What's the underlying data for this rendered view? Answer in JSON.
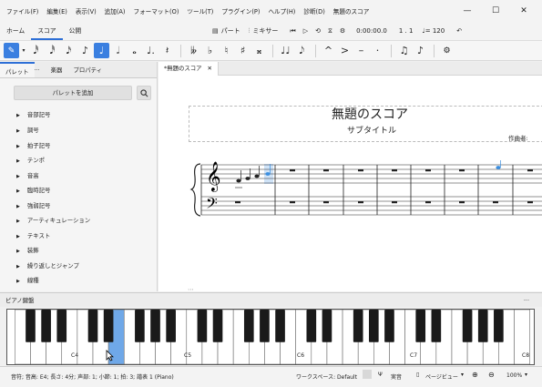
{
  "menu": [
    "ファイル(F)",
    "編集(E)",
    "表示(V)",
    "追加(A)",
    "フォーマット(O)",
    "ツール(T)",
    "プラグイン(P)",
    "ヘルプ(H)",
    "診断(D)",
    "無題のスコア"
  ],
  "window": {
    "minimize": "—",
    "maximize": "☐",
    "close": "✕"
  },
  "tabs": [
    "ホーム",
    "スコア",
    "公開"
  ],
  "toolbar1": {
    "parts": "パート",
    "mixer": "ミキサー",
    "time": "0:00:00.0",
    "position": "1 . 1",
    "tempo": "♩= 120"
  },
  "palette_tabs": [
    "パレット",
    "楽器",
    "プロパティ"
  ],
  "palette_tab_more": "···",
  "add_palette": "パレットを追加",
  "palettes": [
    "音部記号",
    "調号",
    "拍子記号",
    "テンポ",
    "音高",
    "臨時記号",
    "強弱記号",
    "アーティキュレーション",
    "テキスト",
    "装飾",
    "繰り返しとジャンプ",
    "線種"
  ],
  "doc_tab": "*無題のスコア",
  "doc_tab_close": "✕",
  "score": {
    "title": "無題のスコア",
    "subtitle": "サブタイトル",
    "composer": "作曲者:"
  },
  "piano_header": "ピアノ鍵盤",
  "piano_more": "···",
  "octave_labels": [
    "C4",
    "C5",
    "C6",
    "C7",
    "C8"
  ],
  "status": {
    "text": "音符; 音高: E4; 長さ: 4分; 声部: 1; 小節: 1; 拍: 3; 譜表 1 (Piano)",
    "workspace": "ワークスペース: Default",
    "concert": "実音",
    "view": "ページビュー",
    "zoom": "100%"
  },
  "colors": {
    "accent": "#2d6fd6",
    "selected_note": "#3a8ee0",
    "selected_key": "#6fa8e8"
  }
}
